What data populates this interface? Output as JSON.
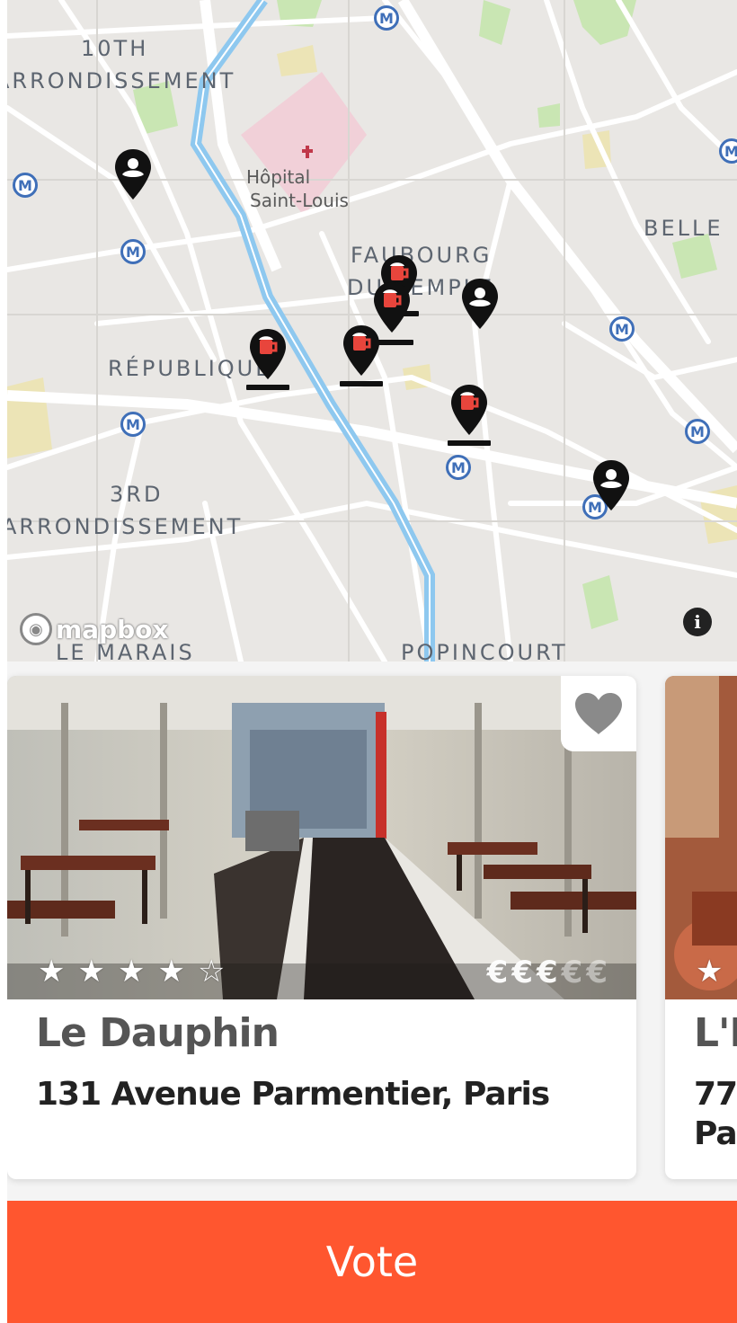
{
  "map": {
    "labels": {
      "district_10_line1": "10TH",
      "district_10_line2": "ARRONDISSEMENT",
      "hospital_line1": "Hôpital",
      "hospital_line2": "Saint-Louis",
      "faubourg_line1": "FAUBOURG",
      "faubourg_line2": "DU TEMPLE",
      "belleville": "BELLE",
      "republique": "RÉPUBLIQUE",
      "district_3_line1": "3RD",
      "district_3_line2": "ARRONDISSEMENT",
      "marais": "LE MARAIS",
      "popincourt": "POPINCOURT"
    },
    "metro_symbol": "M",
    "attribution": "mapbox",
    "info_symbol": "i",
    "colors": {
      "water": "#8ec8ef",
      "park": "#c9e6b3",
      "hospital": "#f1d0d8",
      "pin": "#111111",
      "beer": "#e8453c"
    }
  },
  "cards": [
    {
      "name": "Le Dauphin",
      "address": "131 Avenue Parmentier, Paris",
      "rating": 4,
      "max_rating": 5,
      "price_level": 3,
      "max_price": 5,
      "favorite": false
    },
    {
      "name": "L'E",
      "address_line1": "77",
      "address_line2": "Par",
      "rating": 1
    }
  ],
  "vote_label": "Vote",
  "icons": {
    "star_full": "★",
    "star_empty": "☆",
    "euro": "€",
    "heart": "heart-icon"
  },
  "accent": "#ff562f"
}
